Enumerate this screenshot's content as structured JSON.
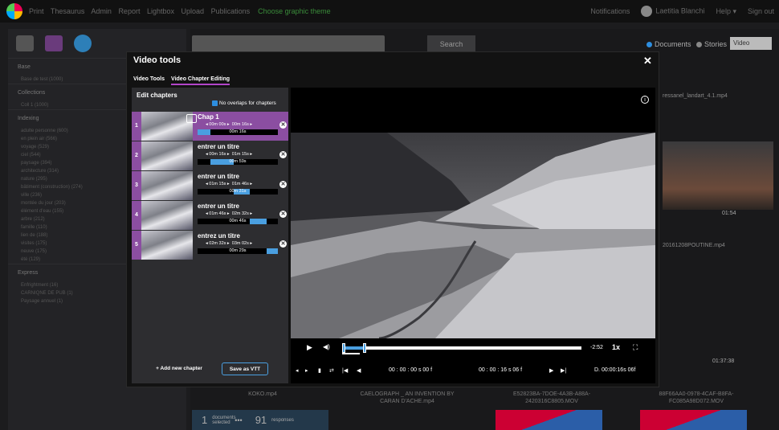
{
  "topbar": {
    "nav": [
      "Print",
      "Thesaurus",
      "Admin",
      "Report",
      "Lightbox",
      "Upload",
      "Publications"
    ],
    "promo": "Choose graphic theme",
    "notifications": "Notifications",
    "user": "Laetitia Blanchi",
    "help": "Help ▾",
    "signout": "Sign out"
  },
  "sidebar": {
    "sections": [
      {
        "label": "Base",
        "items": [
          "Base de test (1000)"
        ]
      },
      {
        "label": "Collections",
        "items": [
          "Coll 1 (1000)"
        ]
      },
      {
        "label": "Indexing",
        "items": [
          "adulte personne (600)",
          "en plein air (566)",
          "voyage (529)",
          "ciel (544)",
          "paysage (394)",
          "architecture (314)",
          "nature (295)",
          "bâtiment (construction) (274)",
          "ville (236)",
          "montée du jour (203)",
          "élément d'eau (155)",
          "arbre (212)",
          "famille (110)",
          "lien de (188)",
          "visites (175)",
          "neuve (175)",
          "été (129)"
        ]
      },
      {
        "label": "Express",
        "items": [
          "Enfrightment (16)",
          "CARNIQNE DE PUB (1)",
          "Paysage annuel (1)"
        ]
      }
    ]
  },
  "main": {
    "search_button": "Search",
    "radio_documents": "Documents",
    "radio_stories": "Stories",
    "select_value": "Video",
    "captions": [
      "KOKO.mp4",
      "CAELOGRAPH _ AN INVENTION BY CARAN D'ACHE.mp4",
      "E52823BA-7DOE-4A3B-A88A-2420316C8805.MOV",
      "88F66AA0-0978-4CAF-B8FA-FC085A98D072.MOV"
    ],
    "right_titles": [
      "ressanel_landart_4.1.mp4",
      "20161208POUTINE.mp4"
    ],
    "durations": [
      "01:54",
      "01:37:38"
    ],
    "selection_count": "1",
    "selection_label": "documents selected",
    "responses_count": "91",
    "responses_label": "responses"
  },
  "modal": {
    "title": "Video tools",
    "close": "✕",
    "tabs": [
      "Video Tools",
      "Video Chapter Editing"
    ],
    "panel_title": "Edit chapters",
    "no_overlaps": "No overlaps for chapters",
    "chapters": [
      {
        "num": "1",
        "title": "Chap 1",
        "start": "00m 00s",
        "end": "00m 16s",
        "duration": "00m 16s",
        "fill_start": 0.0,
        "fill_end": 0.16
      },
      {
        "num": "2",
        "title": "entrer un titre",
        "start": "00m 16s",
        "end": "01m 15s",
        "duration": "00m 59s",
        "fill_start": 0.16,
        "fill_end": 0.45
      },
      {
        "num": "3",
        "title": "entrer un titre",
        "start": "01m 15s",
        "end": "01m 46s",
        "duration": "00m 31s",
        "fill_start": 0.45,
        "fill_end": 0.65
      },
      {
        "num": "4",
        "title": "entrer un titre",
        "start": "01m 46s",
        "end": "02m 32s",
        "duration": "00m 46s",
        "fill_start": 0.65,
        "fill_end": 0.86
      },
      {
        "num": "5",
        "title": "entrez un titre",
        "start": "02m 32s",
        "end": "03m 02s",
        "duration": "00m 29s",
        "fill_start": 0.86,
        "fill_end": 1.0
      }
    ],
    "add_chapter": "+ Add new chapter",
    "save_vtt": "Save as VTT"
  },
  "player": {
    "time_remaining": "-2:52",
    "speed": "1x",
    "timecode_in": "00 : 00 : 00 s 00 f",
    "timecode_out": "00 : 00 : 16 s 06 f",
    "duration_label": "D. 00:00:16s 06f",
    "progress": 0.09
  },
  "colors": {
    "accent": "#8b4ea1",
    "blue": "#4a9fe0"
  }
}
